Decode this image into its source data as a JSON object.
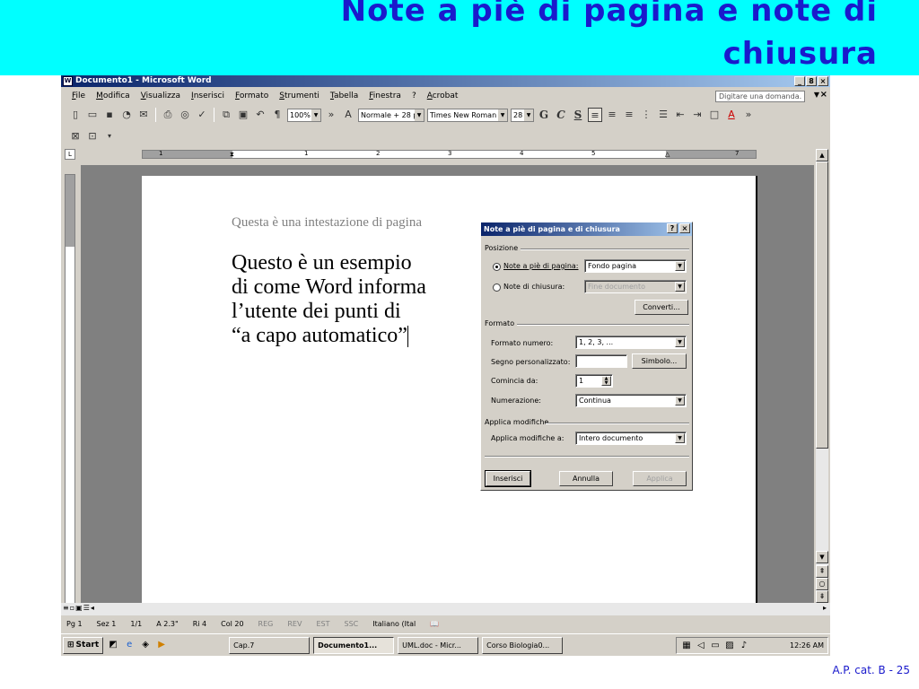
{
  "slide": {
    "title": "Note a piè di pagina e note di chiusura",
    "footer": "A.P. cat. B - 25"
  },
  "window": {
    "title": "Documento1 - Microsoft Word",
    "controls": [
      "_",
      "8",
      "×"
    ]
  },
  "menubar": {
    "items": [
      "File",
      "Modifica",
      "Visualizza",
      "Inserisci",
      "Formato",
      "Strumenti",
      "Tabella",
      "Finestra",
      "?",
      "Acrobat"
    ],
    "help_placeholder": "Digitare una domanda."
  },
  "toolbar": {
    "zoom": "100%",
    "style": "Normale + 28 p",
    "font": "Times New Roman",
    "size": "28",
    "bold": "G",
    "italic": "C",
    "underline": "S"
  },
  "ruler": {
    "numbers": [
      "1",
      "1",
      "2",
      "3",
      "4",
      "5",
      "7"
    ]
  },
  "document": {
    "header": "Questa è una intestazione di pagina",
    "body": "Questo è un esempio\ndi come Word informa\nl’utente dei punti di\n“a capo automatico”"
  },
  "statusbar": {
    "page": "Pg 1",
    "section": "Sez 1",
    "pages": "1/1",
    "at": "A 2.3\"",
    "line": "Ri 4",
    "col": "Col 20",
    "rec": "REG",
    "rev": "REV",
    "ext": "EST",
    "ovr": "SSC",
    "language": "Italiano (Ital"
  },
  "taskbar": {
    "start": "Start",
    "tasks": [
      "Cap.7",
      "Documento1...",
      "UML.doc - Micr...",
      "Corso Biologia0..."
    ],
    "clock": "12:26 AM"
  },
  "dialog": {
    "title": "Note a piè di pagina e di chiusura",
    "posizione_label": "Posizione",
    "footnote_label": "Note a piè di pagina:",
    "footnote_value": "Fondo pagina",
    "endnote_label": "Note di chiusura:",
    "endnote_value": "Fine documento",
    "convert_button": "Converti...",
    "formato_label": "Formato",
    "number_format_label": "Formato numero:",
    "number_format_value": "1, 2, 3, ...",
    "custom_mark_label": "Segno personalizzato:",
    "symbol_button": "Simbolo...",
    "start_at_label": "Comincia da:",
    "start_at_value": "1",
    "numbering_label": "Numerazione:",
    "numbering_value": "Continua",
    "apply_group_label": "Applica modifiche",
    "apply_to_label": "Applica modifiche a:",
    "apply_to_value": "Intero documento",
    "insert_button": "Inserisci",
    "cancel_button": "Annulla",
    "apply_button": "Applica"
  }
}
